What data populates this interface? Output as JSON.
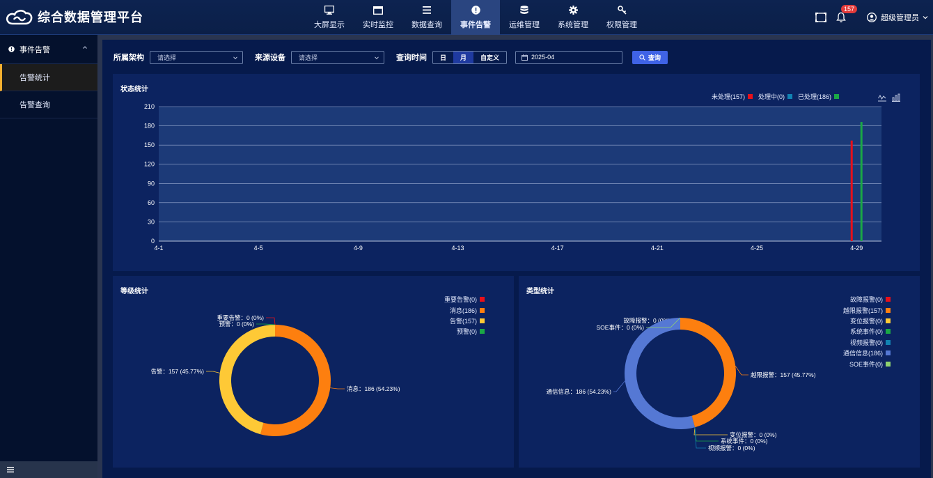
{
  "app": {
    "title": "综合数据管理平台"
  },
  "nav": [
    {
      "label": "大屏显示",
      "icon": "monitor-icon",
      "active": false
    },
    {
      "label": "实时监控",
      "icon": "window-icon",
      "active": false
    },
    {
      "label": "数据查询",
      "icon": "list-icon",
      "active": false
    },
    {
      "label": "事件告警",
      "icon": "alert-icon",
      "active": true
    },
    {
      "label": "运维管理",
      "icon": "database-icon",
      "active": false
    },
    {
      "label": "系统管理",
      "icon": "gear-icon",
      "active": false
    },
    {
      "label": "权限管理",
      "icon": "key-icon",
      "active": false
    }
  ],
  "header": {
    "badge": "157",
    "user": "超级管理员"
  },
  "sidebar": {
    "group": "事件告警",
    "items": [
      {
        "label": "告警统计",
        "active": true
      },
      {
        "label": "告警查询",
        "active": false
      }
    ]
  },
  "filters": {
    "org_label": "所属架构",
    "org_placeholder": "请选择",
    "device_label": "来源设备",
    "device_placeholder": "请选择",
    "time_label": "查询时间",
    "seg": [
      "日",
      "月",
      "自定义"
    ],
    "seg_active": "月",
    "date_value": "2025-04",
    "query_label": "查询"
  },
  "colors": {
    "red": "#e8101a",
    "orange": "#fd7f0f",
    "yellow": "#fec936",
    "green": "#1aa845",
    "teal": "#1183b3",
    "blue": "#5578d4",
    "lightgreen": "#8fd16f"
  },
  "chart_data": [
    {
      "type": "bar",
      "title": "状态统计",
      "legend": [
        {
          "name": "未处理(157)",
          "color": "#e8101a"
        },
        {
          "name": "处理中(0)",
          "color": "#1183b3"
        },
        {
          "name": "已处理(186)",
          "color": "#1aa845"
        }
      ],
      "x_ticks": [
        "4-1",
        "4-5",
        "4-9",
        "4-13",
        "4-17",
        "4-21",
        "4-25",
        "4-29"
      ],
      "x_range": [
        1,
        30
      ],
      "y_ticks": [
        0,
        30,
        60,
        90,
        120,
        150,
        180,
        210
      ],
      "ylim": [
        0,
        210
      ],
      "grid": true,
      "series": [
        {
          "name": "未处理",
          "color": "#e8101a",
          "points": [
            {
              "x": 29,
              "y": 157
            }
          ]
        },
        {
          "name": "处理中",
          "color": "#1183b3",
          "points": [
            {
              "x": 29,
              "y": 0
            }
          ]
        },
        {
          "name": "已处理",
          "color": "#1aa845",
          "points": [
            {
              "x": 29,
              "y": 186
            }
          ]
        }
      ]
    },
    {
      "type": "pie",
      "title": "等级统计",
      "legend": [
        {
          "name": "重要告警(0)",
          "color": "#e8101a"
        },
        {
          "name": "消息(186)",
          "color": "#fd7f0f"
        },
        {
          "name": "告警(157)",
          "color": "#fec936"
        },
        {
          "name": "预警(0)",
          "color": "#1aa845"
        }
      ],
      "slices": [
        {
          "name": "重要告警",
          "value": 0,
          "label": "重要告警：0 (0%)",
          "color": "#e8101a"
        },
        {
          "name": "消息",
          "value": 186,
          "label": "消息：186 (54.23%)",
          "color": "#fd7f0f"
        },
        {
          "name": "告警",
          "value": 157,
          "label": "告警：157 (45.77%)",
          "color": "#fec936"
        },
        {
          "name": "预警",
          "value": 0,
          "label": "预警：0 (0%)",
          "color": "#1aa845"
        }
      ]
    },
    {
      "type": "pie",
      "title": "类型统计",
      "legend": [
        {
          "name": "故障报警(0)",
          "color": "#e8101a"
        },
        {
          "name": "越限报警(157)",
          "color": "#fd7f0f"
        },
        {
          "name": "变位报警(0)",
          "color": "#fec936"
        },
        {
          "name": "系统事件(0)",
          "color": "#1aa845"
        },
        {
          "name": "视频报警(0)",
          "color": "#1183b3"
        },
        {
          "name": "通信信息(186)",
          "color": "#5578d4"
        },
        {
          "name": "SOE事件(0)",
          "color": "#8fd16f"
        }
      ],
      "slices": [
        {
          "name": "故障报警",
          "value": 0,
          "label": "故障报警：0 (0%)",
          "color": "#e8101a"
        },
        {
          "name": "越限报警",
          "value": 157,
          "label": "越限报警：157 (45.77%)",
          "color": "#fd7f0f"
        },
        {
          "name": "变位报警",
          "value": 0,
          "label": "变位报警：0 (0%)",
          "color": "#fec936"
        },
        {
          "name": "系统事件",
          "value": 0,
          "label": "系统事件：0 (0%)",
          "color": "#1aa845"
        },
        {
          "name": "视频报警",
          "value": 0,
          "label": "视频报警：0 (0%)",
          "color": "#1183b3"
        },
        {
          "name": "通信信息",
          "value": 186,
          "label": "通信信息：186 (54.23%)",
          "color": "#5578d4"
        },
        {
          "name": "SOE事件",
          "value": 0,
          "label": "SOE事件：0 (0%)",
          "color": "#8fd16f"
        }
      ]
    }
  ]
}
